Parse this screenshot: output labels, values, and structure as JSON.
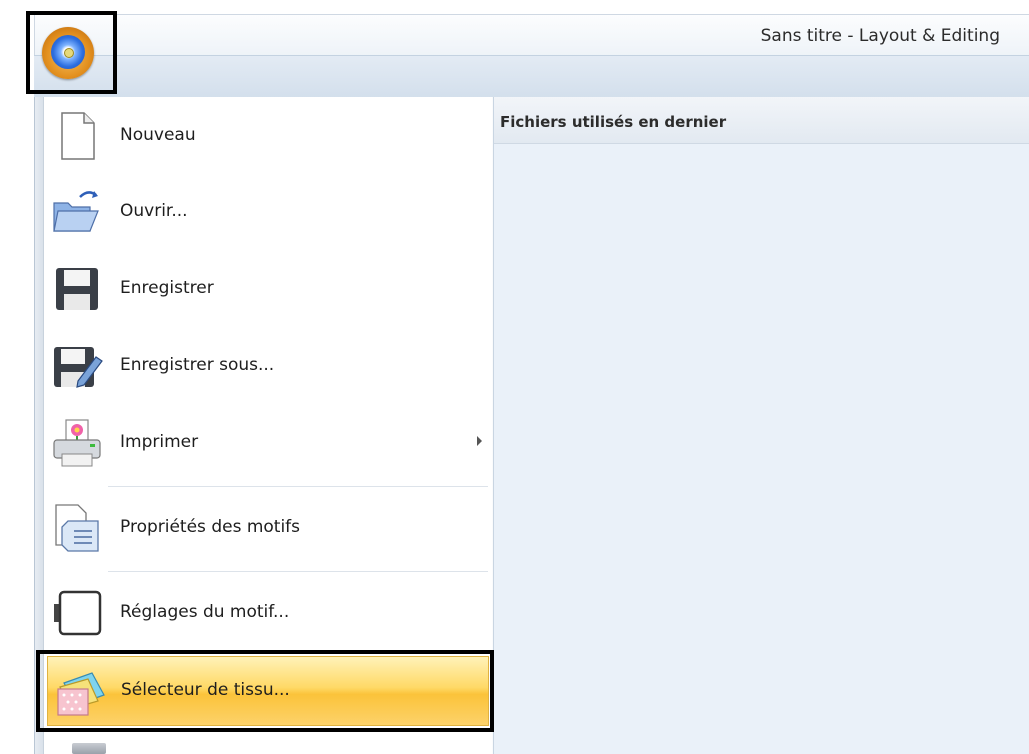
{
  "window": {
    "title": "Sans titre - Layout & Editing"
  },
  "app_menu": {
    "items": [
      {
        "id": "new",
        "label": "Nouveau",
        "icon": "new-document-icon"
      },
      {
        "id": "open",
        "label": "Ouvrir...",
        "icon": "open-folder-icon"
      },
      {
        "id": "save",
        "label": "Enregistrer",
        "icon": "save-icon"
      },
      {
        "id": "save_as",
        "label": "Enregistrer sous...",
        "icon": "save-as-icon"
      },
      {
        "id": "print",
        "label": "Imprimer",
        "icon": "printer-icon",
        "has_submenu": true
      },
      {
        "id": "properties",
        "label": "Propriétés des motifs",
        "icon": "properties-icon"
      },
      {
        "id": "design_settings",
        "label": "Réglages du motif...",
        "icon": "design-settings-icon"
      },
      {
        "id": "fabric_selector",
        "label": "Sélecteur de tissu...",
        "icon": "fabric-selector-icon",
        "highlighted": true
      }
    ],
    "recent_files": {
      "title": "Fichiers utilisés en dernier",
      "items": []
    }
  },
  "colors": {
    "highlight": "#ffd966",
    "recent_bg": "#eaf1f9"
  }
}
